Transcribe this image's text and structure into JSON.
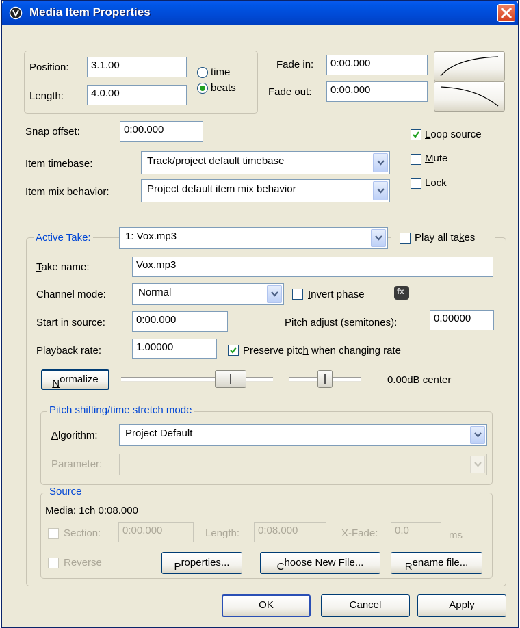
{
  "window": {
    "title": "Media Item Properties"
  },
  "position": {
    "label": "Position:",
    "value": "3.1.00"
  },
  "length": {
    "label": "Length:",
    "value": "4.0.00"
  },
  "units": {
    "time_label": "time",
    "beats_label": "beats",
    "selected": "beats"
  },
  "fade_in": {
    "label": "Fade in:",
    "value": "0:00.000"
  },
  "fade_out": {
    "label": "Fade out:",
    "value": "0:00.000"
  },
  "snap_offset": {
    "label": "Snap offset:",
    "value": "0:00.000"
  },
  "item_timebase": {
    "label": "Item timebase:",
    "value": "Track/project default timebase"
  },
  "item_mix": {
    "label": "Item mix behavior:",
    "value": "Project default item mix behavior"
  },
  "options": {
    "loop_source": {
      "label": "Loop source",
      "checked": true
    },
    "mute": {
      "label": "Mute",
      "checked": false
    },
    "lock": {
      "label": "Lock",
      "checked": false
    }
  },
  "take": {
    "active_take_label": "Active Take:",
    "active_take_value": "1: Vox.mp3",
    "play_all_takes_label": "Play all takes",
    "take_name_label": "Take name:",
    "take_name_value": "Vox.mp3",
    "channel_mode_label": "Channel mode:",
    "channel_mode_value": "Normal",
    "invert_phase_label": "Invert phase",
    "fx_label": "fx",
    "start_in_source_label": "Start in source:",
    "start_in_source_value": "0:00.000",
    "pitch_adjust_label": "Pitch adjust (semitones):",
    "pitch_adjust_value": "0.00000",
    "playback_rate_label": "Playback rate:",
    "playback_rate_value": "1.00000",
    "preserve_pitch_label": "Preserve pitch when changing rate",
    "preserve_pitch_checked": true,
    "normalize_label": "Normalize",
    "volume_pan_readout": "0.00dB center"
  },
  "pitch_group": {
    "legend": "Pitch shifting/time stretch mode",
    "algorithm_label": "Algorithm:",
    "algorithm_value": "Project Default",
    "parameter_label": "Parameter:",
    "parameter_value": ""
  },
  "source": {
    "legend": "Source",
    "media_info": "Media: 1ch 0:08.000",
    "section_label": "Section:",
    "section_value": "0:00.000",
    "length_label": "Length:",
    "length_value": "0:08.000",
    "xfade_label": "X-Fade:",
    "xfade_value": "0.0",
    "ms_label": "ms",
    "reverse_label": "Reverse",
    "properties_button": "Properties...",
    "choose_new_file_button": "Choose New File...",
    "rename_file_button": "Rename file..."
  },
  "footer": {
    "ok": "OK",
    "cancel": "Cancel",
    "apply": "Apply"
  },
  "icons": {
    "app": "reaper-logo-icon",
    "close": "close-icon",
    "dropdown": "chevron-down-icon",
    "check": "check-icon"
  }
}
